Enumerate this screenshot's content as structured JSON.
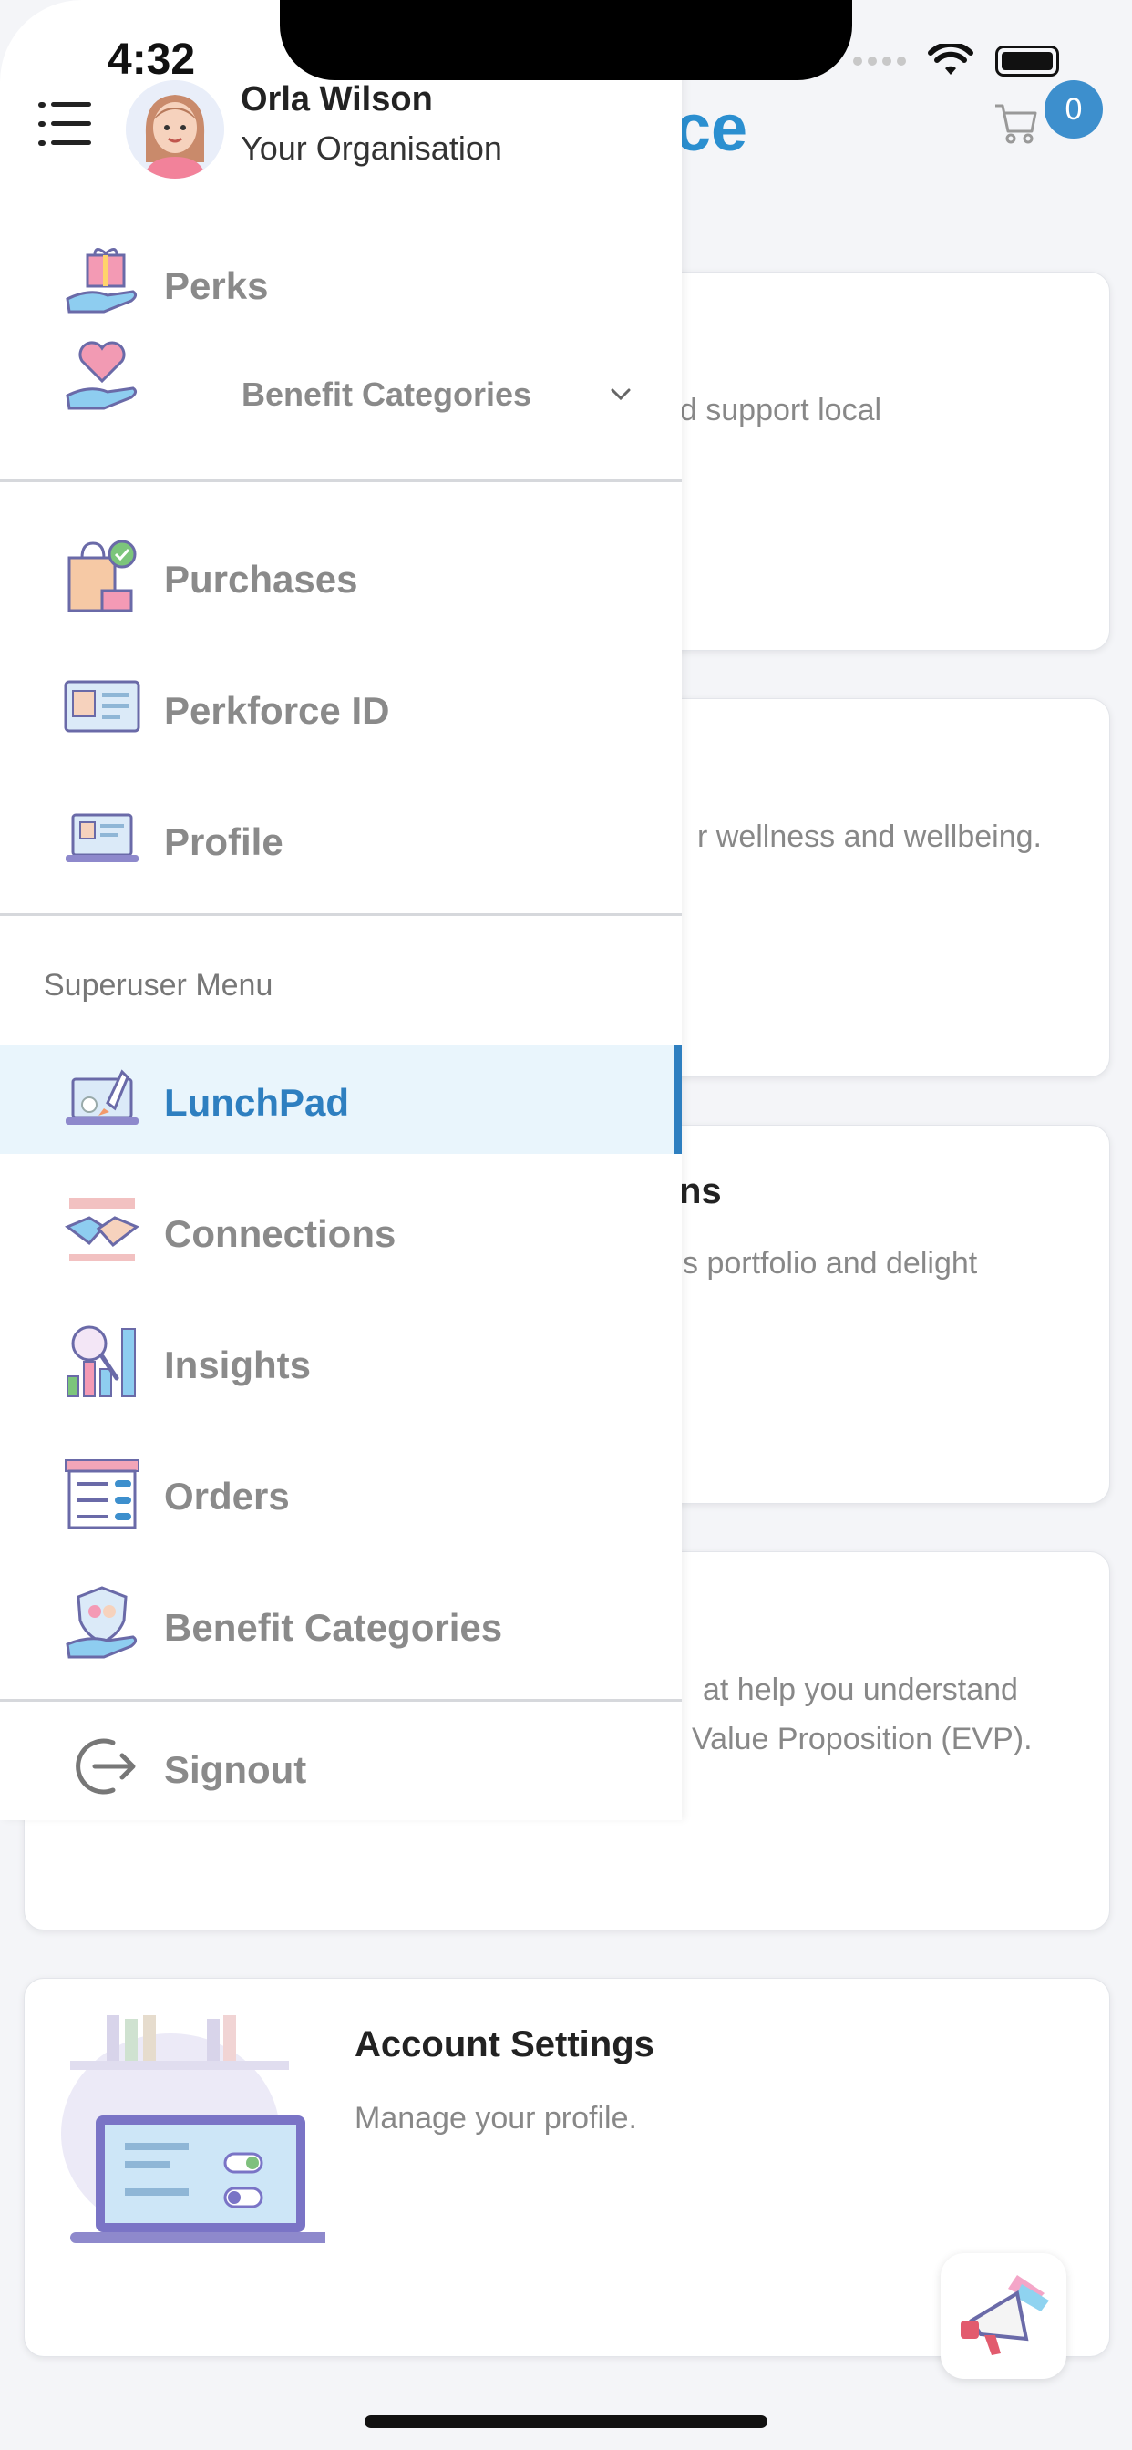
{
  "status_bar": {
    "time": "4:32"
  },
  "header": {
    "logo_fragment": "ce",
    "cart_count": "0",
    "cart_icon": "cart-icon"
  },
  "background_cards": [
    {
      "title": "",
      "description": "nd support local"
    },
    {
      "title": "",
      "description": "r wellness and wellbeing."
    },
    {
      "title": "ns",
      "description": "s portfolio and delight"
    },
    {
      "title": "",
      "description_line1": "at help you understand",
      "description_line2": "Value Proposition (EVP)."
    },
    {
      "title": "Account Settings",
      "description": "Manage your profile."
    }
  ],
  "drawer": {
    "user": {
      "name": "Orla Wilson",
      "organisation": "Your Organisation"
    },
    "items": [
      {
        "label": "Perks",
        "icon": "gift-hand-icon"
      },
      {
        "label": "Benefit Categories",
        "icon": "heart-hand-icon",
        "expandable": true
      },
      {
        "label": "Purchases",
        "icon": "shopping-bag-icon"
      },
      {
        "label": "Perkforce ID",
        "icon": "id-card-icon"
      },
      {
        "label": "Profile",
        "icon": "laptop-profile-icon"
      }
    ],
    "superuser_section_title": "Superuser Menu",
    "superuser_items": [
      {
        "label": "LunchPad",
        "icon": "rocket-laptop-icon",
        "active": true
      },
      {
        "label": "Connections",
        "icon": "handshake-icon"
      },
      {
        "label": "Insights",
        "icon": "chart-magnifier-icon"
      },
      {
        "label": "Orders",
        "icon": "store-list-icon"
      },
      {
        "label": "Benefit Categories",
        "icon": "shield-hand-icon"
      }
    ],
    "signout_label": "Signout"
  },
  "colors": {
    "accent": "#2e7fc0",
    "active_bg": "#e9f5fc",
    "badge": "#3d8fcd"
  }
}
